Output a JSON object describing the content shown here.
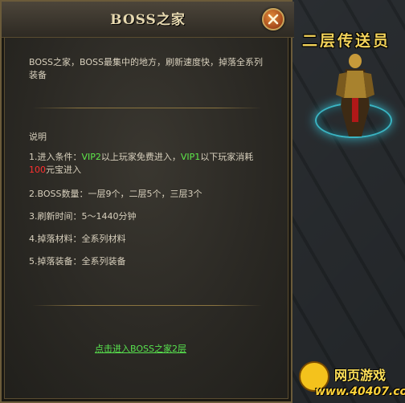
{
  "dialog": {
    "title": "BOSS之家",
    "intro": "BOSS之家，BOSS最集中的地方，刷新速度快，掉落全系列装备",
    "section_label": "说明",
    "items": [
      {
        "parts": [
          {
            "text": "1.进入条件：",
            "color": "normal"
          },
          {
            "text": "VIP2",
            "color": "green"
          },
          {
            "text": "以上玩家免费进入，",
            "color": "normal"
          },
          {
            "text": "VIP1",
            "color": "green"
          },
          {
            "text": "以下玩家消耗",
            "color": "normal"
          },
          {
            "text": "100",
            "color": "red"
          },
          {
            "text": "元宝进入",
            "color": "normal"
          }
        ]
      },
      {
        "parts": [
          {
            "text": "2.BOSS数量：一层9个，二层5个，三层3个",
            "color": "normal"
          }
        ]
      },
      {
        "parts": [
          {
            "text": "3.刷新时间：5～1440分钟",
            "color": "normal"
          }
        ]
      },
      {
        "parts": [
          {
            "text": "4.掉落材料：全系列材料",
            "color": "normal"
          }
        ]
      },
      {
        "parts": [
          {
            "text": "5.掉落装备：全系列装备",
            "color": "normal"
          }
        ]
      }
    ],
    "enter_link": "点击进入BOSS之家2层",
    "close_icon": "close-icon"
  },
  "npc": {
    "title": "二层传送员"
  },
  "watermark": {
    "line1": "网页游戏",
    "line2": "www.40407.com"
  },
  "colors": {
    "green": "#5ee84a",
    "red": "#ff3030",
    "title": "#e7d9b0",
    "npc_title": "#f3d35a"
  }
}
